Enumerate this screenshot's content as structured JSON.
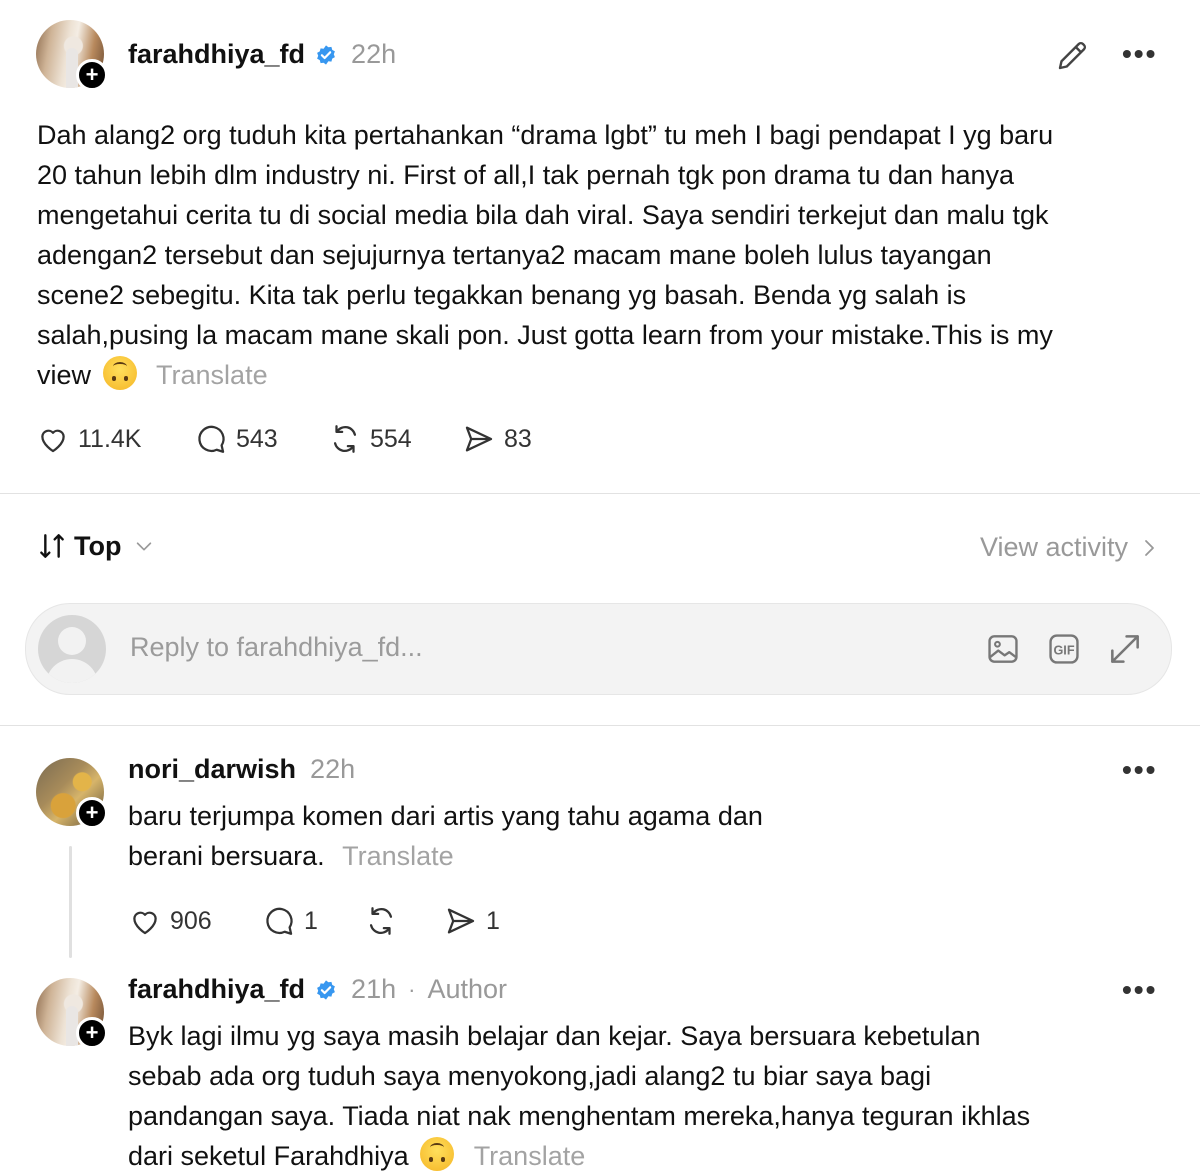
{
  "post": {
    "username": "farahdhiya_fd",
    "time": "22h",
    "text": "Dah alang2 org tuduh kita pertahankan “drama lgbt” tu meh I bagi pendapat I yg baru 20 tahun lebih dlm industry ni. First of all,I tak pernah tgk pon drama tu dan hanya mengetahui cerita tu di social media bila dah viral. Saya sendiri terkejut dan malu tgk adengan2 tersebut dan sejujurnya tertanya2 macam mane boleh lulus tayangan scene2 sebegitu. Kita tak perlu tegakkan benang yg basah. Benda yg salah is salah,pusing la macam mane skali pon. Just gotta learn from your mistake.This is my view",
    "translate": "Translate",
    "likes": "11.4K",
    "comments": "543",
    "reposts": "554",
    "shares": "83"
  },
  "sort": {
    "label": "Top",
    "view_activity": "View activity"
  },
  "reply": {
    "placeholder": "Reply to farahdhiya_fd..."
  },
  "comments": [
    {
      "username": "nori_darwish",
      "time": "22h",
      "text": "baru terjumpa komen dari artis yang tahu agama dan berani bersuara.",
      "translate": "Translate",
      "likes": "906",
      "comments": "1",
      "shares": "1"
    },
    {
      "username": "farahdhiya_fd",
      "time": "21h",
      "author_separator": "·",
      "author_label": "Author",
      "text": "Byk lagi ilmu yg saya masih belajar dan kejar. Saya bersuara kebetulan sebab ada org tuduh saya menyokong,jadi alang2 tu biar saya bagi pandangan saya. Tiada niat nak menghentam mereka,hanya teguran ikhlas dari seketul Farahdhiya",
      "translate": "Translate"
    }
  ],
  "colors": {
    "verified": "#3797f0",
    "muted": "#999999",
    "text": "#111111"
  }
}
